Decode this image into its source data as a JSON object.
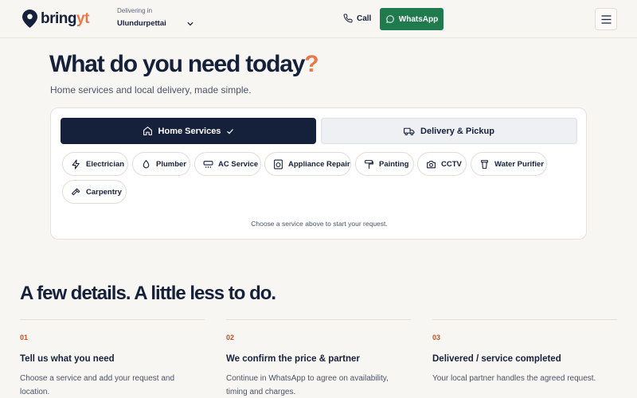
{
  "header": {
    "logo_text_main": "bring",
    "logo_text_accent": "yt",
    "deliver_label": "Delivering in",
    "location": "Ulundurpettai",
    "call_label": "Call",
    "whatsapp_label": "WhatsApp"
  },
  "hero": {
    "title": "What do you need today",
    "title_mark": "?",
    "subtitle": "Home services and local delivery, made simple."
  },
  "tabs": {
    "home": "Home Services",
    "delivery": "Delivery & Pickup"
  },
  "services": [
    {
      "label": "Electrician",
      "icon": "bolt-icon"
    },
    {
      "label": "Plumber",
      "icon": "droplet-icon"
    },
    {
      "label": "AC Service",
      "icon": "ac-icon"
    },
    {
      "label": "Appliance Repair",
      "icon": "washing-machine-icon"
    },
    {
      "label": "Painting",
      "icon": "paint-roller-icon"
    },
    {
      "label": "CCTV",
      "icon": "camera-icon"
    },
    {
      "label": "Water Purifier",
      "icon": "purifier-icon"
    },
    {
      "label": "Carpentry",
      "icon": "hammer-icon"
    }
  ],
  "hint": "Choose a service above to start your request.",
  "steps_section": {
    "title": "A few details. A little less to do.",
    "steps": [
      {
        "num": "01",
        "title": "Tell us what you need",
        "desc": "Choose a service and add your request and location."
      },
      {
        "num": "02",
        "title": "We confirm the price & partner",
        "desc": "Continue in WhatsApp to agree on availability, timing and charges."
      },
      {
        "num": "03",
        "title": "Delivered / service completed",
        "desc": "Your local partner handles the agreed request."
      }
    ]
  },
  "colors": {
    "navy": "#15213a",
    "accent": "#e8794c",
    "whatsapp_green": "#1f7a4d",
    "step_number": "#c4532a"
  }
}
